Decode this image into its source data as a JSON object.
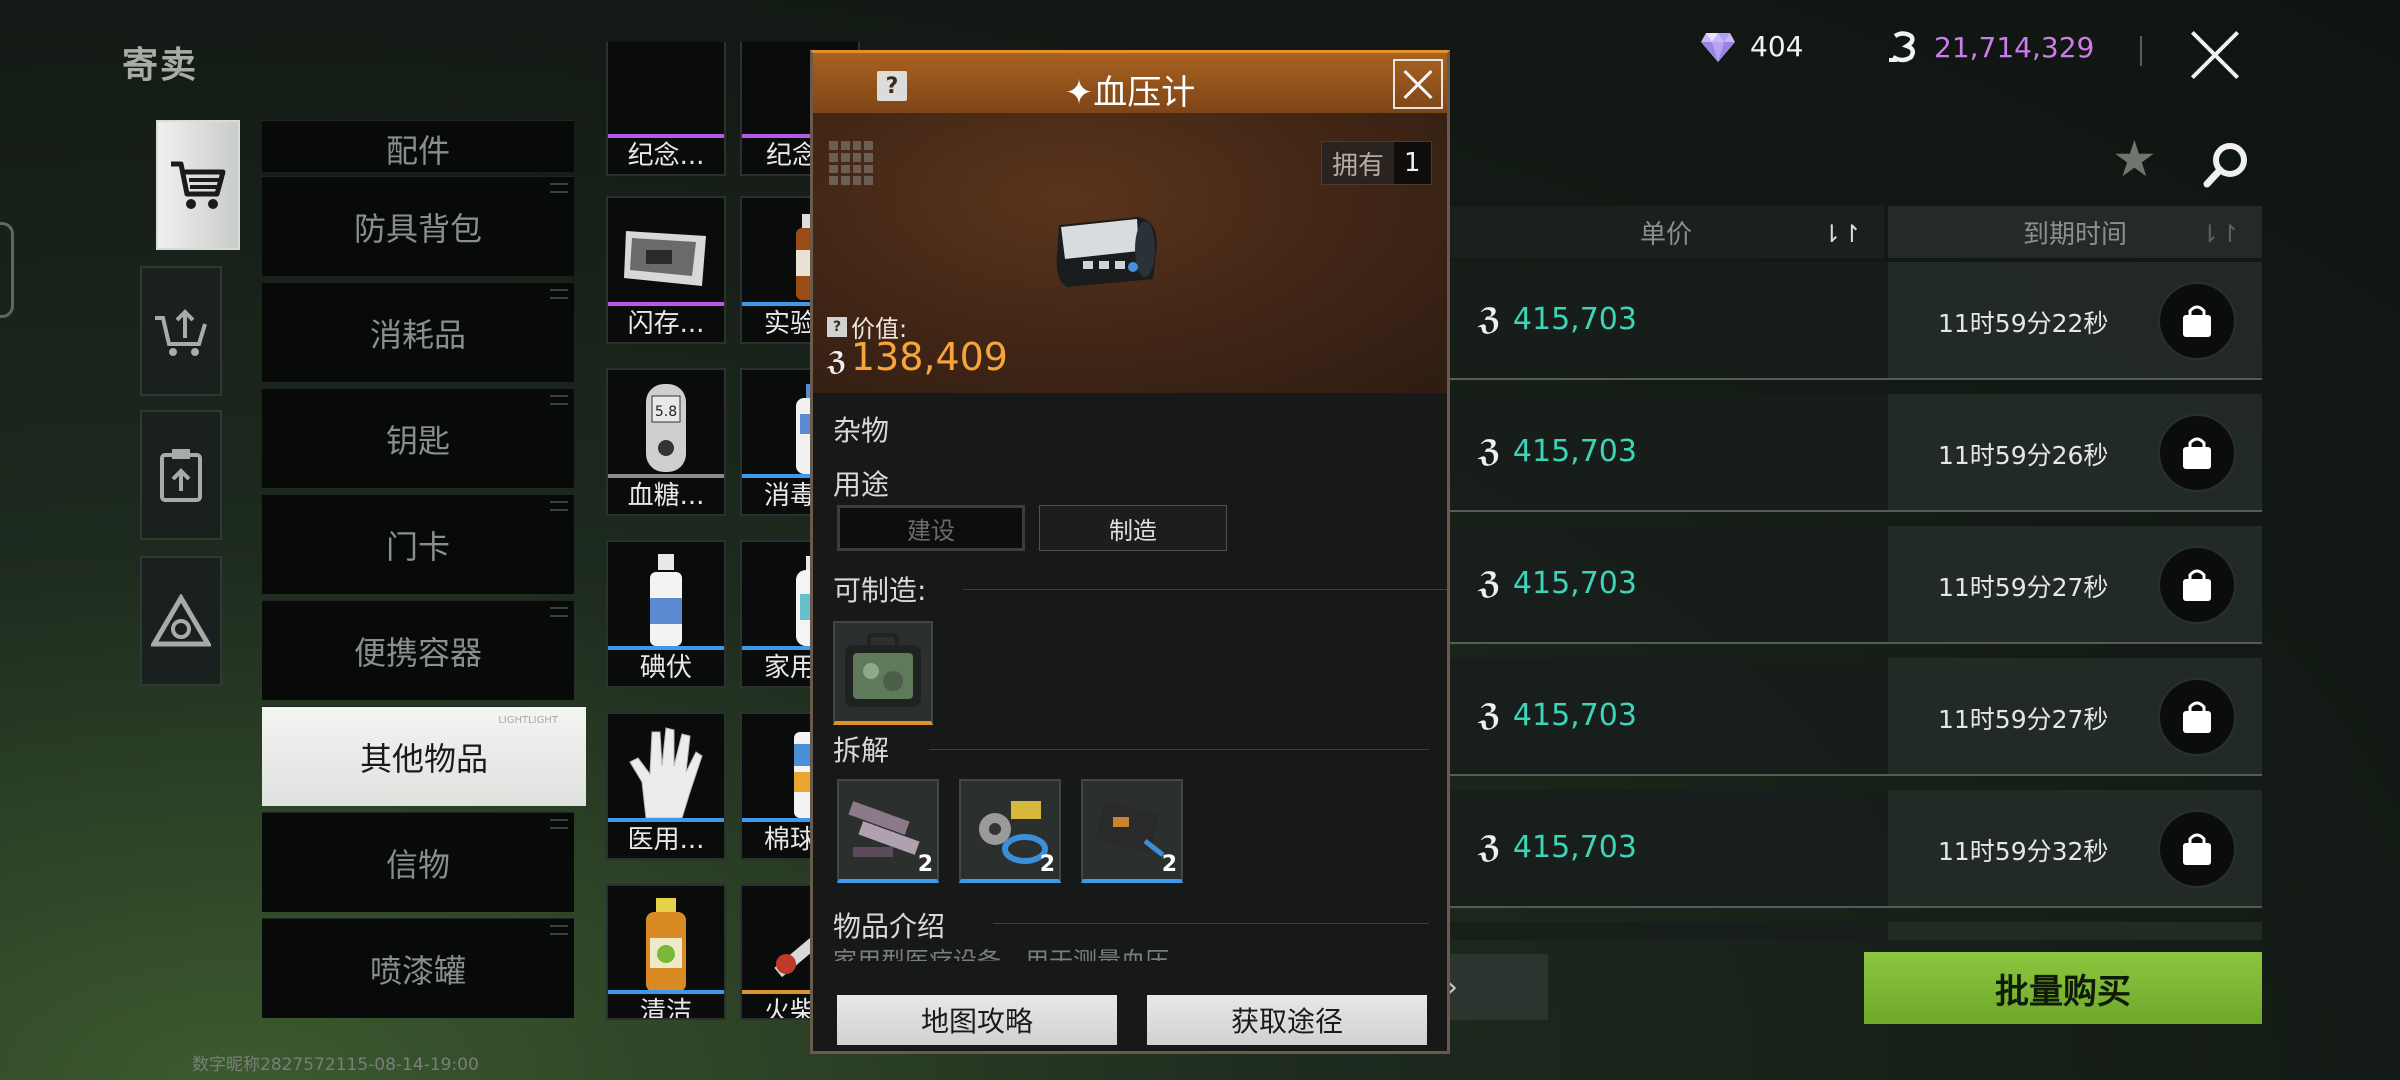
{
  "header": {
    "title": "寄卖",
    "gems": "404",
    "coins": "21,714,329"
  },
  "sidebar": {
    "tabs": [
      {
        "icon": "shopping-cart-icon",
        "active": true
      },
      {
        "icon": "cart-upload-icon",
        "active": false
      },
      {
        "icon": "clipboard-upload-icon",
        "active": false
      },
      {
        "icon": "triangle-emblem-icon",
        "active": false
      }
    ]
  },
  "categories": [
    {
      "label": "配件"
    },
    {
      "label": "防具背包"
    },
    {
      "label": "消耗品"
    },
    {
      "label": "钥匙"
    },
    {
      "label": "门卡"
    },
    {
      "label": "便携容器"
    },
    {
      "label": "其他物品",
      "active": true,
      "tag": "LIGHTLIGHT"
    },
    {
      "label": "信物"
    },
    {
      "label": "喷漆罐"
    }
  ],
  "items": {
    "col1": [
      {
        "name": "纪念...",
        "rarity": "purple"
      },
      {
        "name": "闪存...",
        "rarity": "purple"
      },
      {
        "name": "血糖...",
        "rarity": "gray"
      },
      {
        "name": "碘伏",
        "rarity": "blue"
      },
      {
        "name": "医用...",
        "rarity": "blue"
      },
      {
        "name": "清洁",
        "rarity": "blue"
      }
    ],
    "col2": [
      {
        "name": "纪念",
        "rarity": "purple"
      },
      {
        "name": "实验",
        "rarity": "blue"
      },
      {
        "name": "消毒",
        "rarity": "blue"
      },
      {
        "name": "家用",
        "rarity": "blue"
      },
      {
        "name": "棉球",
        "rarity": "blue"
      },
      {
        "name": "火柴",
        "rarity": "orange"
      }
    ]
  },
  "table": {
    "col_price": "单价",
    "col_expire": "到期时间",
    "rows": [
      {
        "price": "415,703",
        "expire": "11时59分22秒"
      },
      {
        "price": "415,703",
        "expire": "11时59分26秒"
      },
      {
        "price": "415,703",
        "expire": "11时59分27秒"
      },
      {
        "price": "415,703",
        "expire": "11时59分27秒"
      },
      {
        "price": "415,703",
        "expire": "11时59分32秒"
      }
    ]
  },
  "bulk_buy_label": "批量购买",
  "footer_text": "数字昵称2827572115-08-14-19:00",
  "detail": {
    "help_mark": "?",
    "title": "✦血压计",
    "own_label": "拥有",
    "own_count": "1",
    "value_label": "价值:",
    "value": "138,409",
    "type": "杂物",
    "use_title": "用途",
    "use_buttons": [
      "建设",
      "制造"
    ],
    "craftable_title": "可制造:",
    "dismantle_title": "拆解",
    "materials": [
      {
        "count": "2"
      },
      {
        "count": "2"
      },
      {
        "count": "2"
      }
    ],
    "desc_title": "物品介绍",
    "desc_text": "家用型医疗设备，用于测量血压",
    "btn_map": "地图攻略",
    "btn_source": "获取途径"
  },
  "colors": {
    "accent_green": "#8cc63f",
    "price_teal": "#3ed4b8",
    "value_orange": "#f7a53a",
    "coin_purple": "#d07af0",
    "header_brown": "#a86220"
  }
}
